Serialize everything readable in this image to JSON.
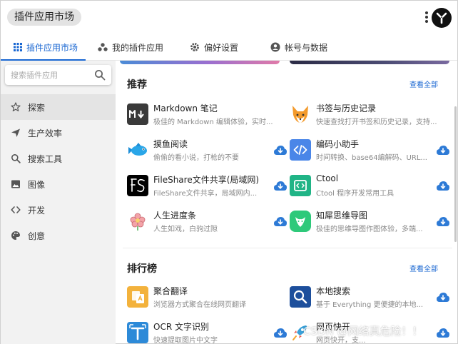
{
  "window": {
    "title": "插件应用市场"
  },
  "tabs": [
    {
      "label": "插件应用市场",
      "icon": "grid-icon",
      "active": true
    },
    {
      "label": "我的插件应用",
      "icon": "apps-dots-icon"
    },
    {
      "label": "偏好设置",
      "icon": "gear-icon"
    },
    {
      "label": "帐号与数据",
      "icon": "account-icon"
    }
  ],
  "search": {
    "placeholder": "搜索插件应用"
  },
  "sidebar": {
    "items": [
      {
        "label": "探索",
        "icon": "star-icon",
        "active": true
      },
      {
        "label": "生产效率",
        "icon": "send-icon"
      },
      {
        "label": "搜索工具",
        "icon": "search-icon"
      },
      {
        "label": "图像",
        "icon": "image-icon"
      },
      {
        "label": "开发",
        "icon": "code-icon"
      },
      {
        "label": "创意",
        "icon": "palette-icon"
      }
    ]
  },
  "sections": {
    "recommend": {
      "title": "推荐",
      "more": "查看全部"
    },
    "ranking": {
      "title": "排行榜",
      "more": "查看全部"
    }
  },
  "recommend_apps": [
    {
      "name": "Markdown 笔记",
      "desc": "极佳的 Markdown 编辑体验，实时...",
      "icon": "markdown-icon",
      "icon_bg": "#3a3a3a",
      "download": false
    },
    {
      "name": "书签与历史记录",
      "desc": "快速查找打开书签和历史记录，支持...",
      "icon": "fox-icon",
      "icon_bg": "#ffffff",
      "download": false
    },
    {
      "name": "摸鱼阅读",
      "desc": "偷偷的看小说，打枪的不要",
      "icon": "fish-icon",
      "icon_bg": "#ffffff",
      "download": true
    },
    {
      "name": "编码小助手",
      "desc": "时间转换、base64编解码、URL...",
      "icon": "code-brackets-icon",
      "icon_bg": "#4a86e8",
      "download": true
    },
    {
      "name": "FileShare文件共享(局域网)",
      "desc": "FileShare文件共享，局域网内...",
      "icon": "fs-logo-icon",
      "icon_bg": "#000000",
      "download": true
    },
    {
      "name": "Ctool",
      "desc": "Ctool 程序开发常用工具",
      "icon": "ctool-icon",
      "icon_bg": "#20b486",
      "download": true
    },
    {
      "name": "人生进度条",
      "desc": "人生如戏，白驹过隙",
      "icon": "flower-icon",
      "icon_bg": "#ffffff",
      "download": true
    },
    {
      "name": "知犀思维导图",
      "desc": "极佳的思维导图作图体验，多端...",
      "icon": "mindmap-icon",
      "icon_bg": "#2ec97a",
      "download": true
    }
  ],
  "ranking_apps": [
    {
      "name": "聚合翻译",
      "desc": "浏览器方式聚合在线网页翻译",
      "icon": "translate-icon",
      "icon_bg": "#f3b23c",
      "download": false
    },
    {
      "name": "本地搜索",
      "desc": "基于 Everything 更便捷的本地...",
      "icon": "local-search-icon",
      "icon_bg": "#1d4f9c",
      "download": true
    },
    {
      "name": "OCR 文字识别",
      "desc": "快速提取图片中文字",
      "icon": "ocr-icon",
      "icon_bg": "#2d8ad8",
      "download": true
    },
    {
      "name": "网页快开",
      "desc": "网页快开，支...",
      "icon": "rocket-icon",
      "icon_bg": "#ffffff",
      "download": true
    }
  ],
  "watermark": "CSDN @网络真危险！！",
  "colors": {
    "accent": "#1a67d2",
    "sidebar_bg": "#f2f2f2",
    "download_icon": "#2d7ad6"
  }
}
